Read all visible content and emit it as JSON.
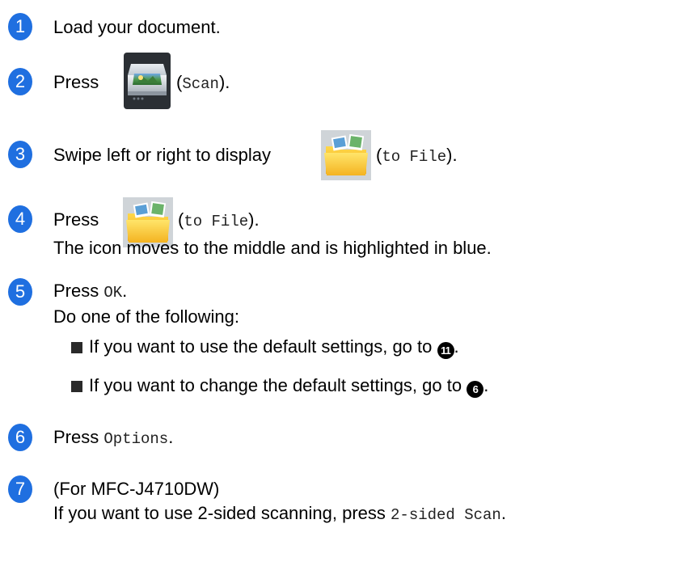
{
  "steps": [
    {
      "number": "1",
      "text": "Load your document."
    },
    {
      "number": "2",
      "pre": "Press",
      "post_open": "(",
      "mono": "Scan",
      "post_close": ")."
    },
    {
      "number": "3",
      "pre": "Swipe left or right to display",
      "post_open": "(",
      "mono": "to File",
      "post_close": ")."
    },
    {
      "number": "4",
      "pre": "Press",
      "post_open": "(",
      "mono": "to File",
      "post_close": ").",
      "line2": "The icon moves to the middle and is highlighted in blue."
    },
    {
      "number": "5",
      "pre": "Press ",
      "mono": "OK",
      "post": ".",
      "line2": "Do one of the following:",
      "bullets": [
        {
          "text": "If you want to use the default settings, go to",
          "ref": "11",
          "end": "."
        },
        {
          "text": "If you want to change the default settings, go to",
          "ref": "6",
          "end": "."
        }
      ]
    },
    {
      "number": "6",
      "pre": "Press ",
      "mono": "Options",
      "post": "."
    },
    {
      "number": "7",
      "text": "(For MFC-J4710DW)",
      "line2_pre": "If you want to use 2-sided scanning, press ",
      "line2_mono": "2-sided Scan",
      "line2_post": "."
    }
  ],
  "colors": {
    "step_badge": "#1f6fe0",
    "bullet": "#2a2a2a"
  },
  "icons": {
    "scan": "scanner-icon",
    "to_file": "folder-photo-icon"
  }
}
